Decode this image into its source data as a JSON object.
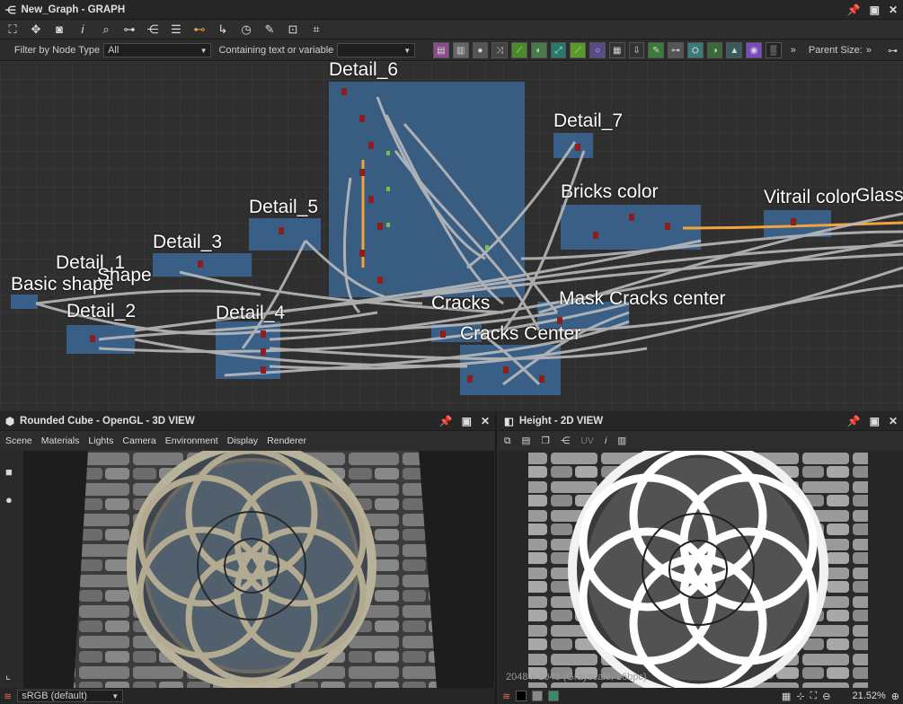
{
  "graph_panel": {
    "title": "New_Graph - GRAPH",
    "filter_label": "Filter by Node Type",
    "filter_value": "All",
    "search_label": "Containing text or variable",
    "search_value": "",
    "parent_size_label": "Parent Size:",
    "more_label": "»"
  },
  "frames": [
    {
      "label": "Detail_6"
    },
    {
      "label": "Detail_7"
    },
    {
      "label": "Detail_5"
    },
    {
      "label": "Detail_3"
    },
    {
      "label": "Detail_1"
    },
    {
      "label": "Shape"
    },
    {
      "label": "Basic shape"
    },
    {
      "label": "Detail_2"
    },
    {
      "label": "Detail_4"
    },
    {
      "label": "Bricks color"
    },
    {
      "label": "Vitrail color"
    },
    {
      "label": "Glass"
    },
    {
      "label": "Cracks"
    },
    {
      "label": "Cracks Center"
    },
    {
      "label": "Mask Cracks center"
    }
  ],
  "view3d": {
    "title": "Rounded Cube - OpenGL - 3D VIEW",
    "menu": [
      "Scene",
      "Materials",
      "Lights",
      "Camera",
      "Environment",
      "Display",
      "Renderer"
    ],
    "colorspace": "sRGB (default)"
  },
  "view2d": {
    "title": "Height - 2D VIEW",
    "uv_label": "UV",
    "info": "2048 x 2048 (Grayscale, 16bpc)",
    "zoom": "21.52%"
  }
}
